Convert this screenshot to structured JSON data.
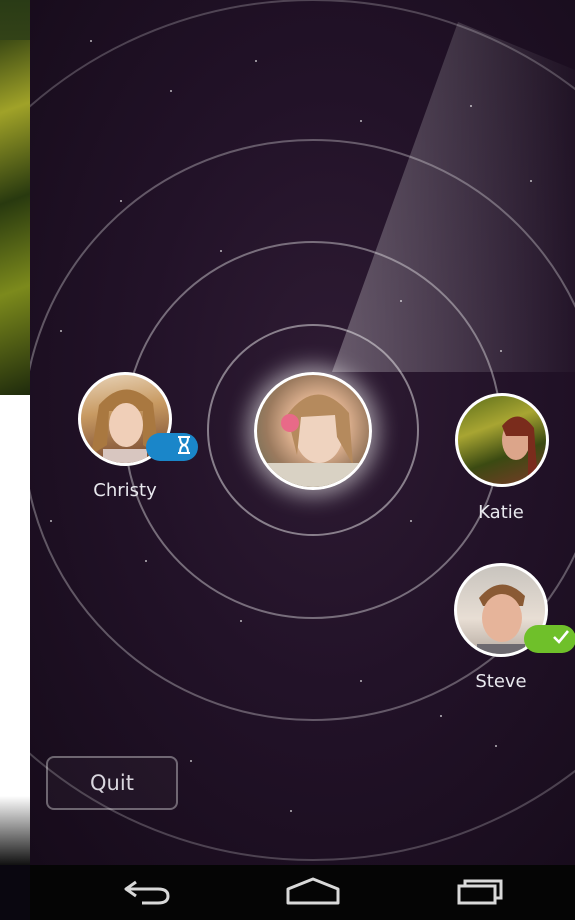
{
  "peers": [
    {
      "name": "Christy",
      "status": "waiting"
    },
    {
      "name": "Katie",
      "status": "none"
    },
    {
      "name": "Steve",
      "status": "accepted"
    }
  ],
  "actions": {
    "quit_label": "Quit"
  },
  "icons": {
    "waiting_badge": "hourglass-icon",
    "accepted_badge": "checkmark-icon",
    "nav_back": "back-icon",
    "nav_home": "home-icon",
    "nav_recents": "recents-icon"
  },
  "colors": {
    "background": "#221228",
    "waiting_badge": "#1a86c9",
    "accepted_badge": "#6fc02a"
  }
}
